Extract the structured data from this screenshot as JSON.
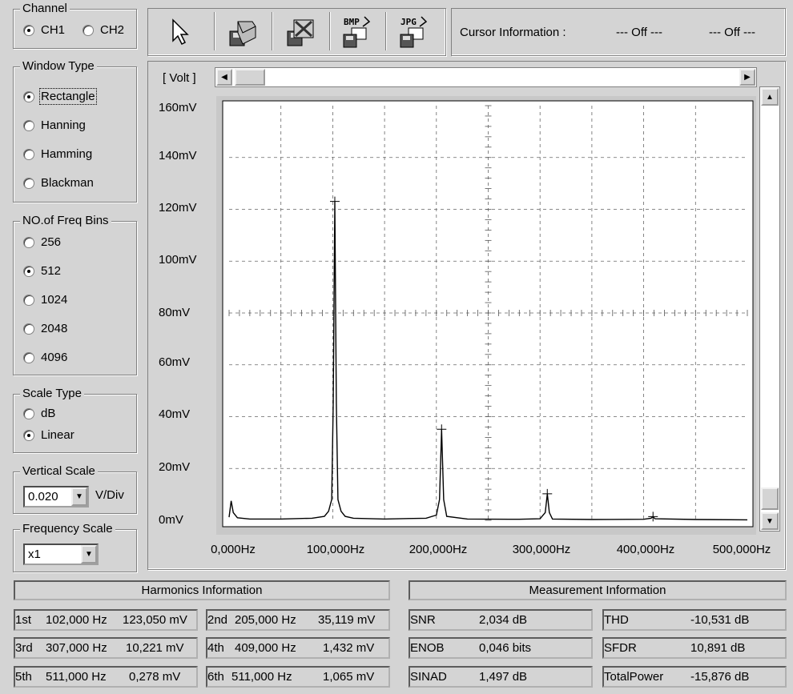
{
  "channel": {
    "title": "Channel",
    "options": [
      {
        "label": "CH1",
        "selected": true
      },
      {
        "label": "CH2",
        "selected": false
      }
    ]
  },
  "window_type": {
    "title": "Window Type",
    "options": [
      {
        "label": "Rectangle",
        "selected": true
      },
      {
        "label": "Hanning",
        "selected": false
      },
      {
        "label": "Hamming",
        "selected": false
      },
      {
        "label": "Blackman",
        "selected": false
      }
    ]
  },
  "freq_bins": {
    "title": "NO.of Freq Bins",
    "options": [
      {
        "label": "256",
        "selected": false
      },
      {
        "label": "512",
        "selected": true
      },
      {
        "label": "1024",
        "selected": false
      },
      {
        "label": "2048",
        "selected": false
      },
      {
        "label": "4096",
        "selected": false
      }
    ]
  },
  "scale_type": {
    "title": "Scale Type",
    "options": [
      {
        "label": "dB",
        "selected": false
      },
      {
        "label": "Linear",
        "selected": true
      }
    ]
  },
  "vertical_scale": {
    "title": "Vertical Scale",
    "value": "0.020",
    "unit": "V/Div"
  },
  "frequency_scale": {
    "title": "Frequency Scale",
    "value": "x1"
  },
  "toolbar": {
    "icons": [
      "cursor-arrow-icon",
      "save-disk-icon",
      "clear-disk-icon",
      "bmp-export-icon",
      "jpg-export-icon"
    ],
    "bmp_text": "BMP",
    "jpg_text": "JPG"
  },
  "cursor_info": {
    "label": "Cursor Information :",
    "value1": "--- Off ---",
    "value2": "--- Off ---"
  },
  "plot": {
    "unit_label": "[ Volt ]",
    "horizontal_scroll_position": 0.0,
    "vertical_scroll_position": 1.0
  },
  "chart_data": {
    "type": "line",
    "title": "",
    "xlabel": "",
    "ylabel": "[ Volt ]",
    "xlim": [
      0,
      500000
    ],
    "ylim": [
      0,
      160
    ],
    "y_ticks": [
      "160mV",
      "140mV",
      "120mV",
      "100mV",
      "80mV",
      "60mV",
      "40mV",
      "20mV",
      "0mV"
    ],
    "x_ticks": [
      "0,000Hz",
      "100,000Hz",
      "200,000Hz",
      "300,000Hz",
      "400,000Hz",
      "500,000Hz"
    ],
    "grid": true,
    "series": [
      {
        "x": [
          0,
          2000,
          4000,
          8000,
          20000,
          50000,
          80000,
          92000,
          96000,
          99000,
          100500,
          102000,
          103500,
          105000,
          108000,
          112000,
          120000,
          150000,
          190000,
          200000,
          203000,
          205000,
          207000,
          210000,
          230000,
          280000,
          300000,
          305000,
          307000,
          309000,
          312000,
          350000,
          400000,
          407000,
          409000,
          411000,
          450000,
          500000
        ],
        "y": [
          1.2,
          7.5,
          3.0,
          1.0,
          0.5,
          0.5,
          0.8,
          1.5,
          3.5,
          8.0,
          45.0,
          123.0,
          45.0,
          8.0,
          3.5,
          1.5,
          0.8,
          0.5,
          0.8,
          2.0,
          8.0,
          35.0,
          8.0,
          1.5,
          0.5,
          0.4,
          0.6,
          3.0,
          10.2,
          3.0,
          0.5,
          0.3,
          0.4,
          0.8,
          1.4,
          0.6,
          0.3,
          0.2
        ]
      }
    ],
    "markers": [
      {
        "x": 102000,
        "y": 123.05
      },
      {
        "x": 205000,
        "y": 35.119
      },
      {
        "x": 307000,
        "y": 10.221
      },
      {
        "x": 409000,
        "y": 1.432
      }
    ]
  },
  "harmonics": {
    "title": "Harmonics Information",
    "rows": [
      {
        "order": "1st",
        "freq": "102,000 Hz",
        "value": "123,050 mV"
      },
      {
        "order": "2nd",
        "freq": "205,000 Hz",
        "value": "35,119 mV"
      },
      {
        "order": "3rd",
        "freq": "307,000 Hz",
        "value": "10,221 mV"
      },
      {
        "order": "4th",
        "freq": "409,000 Hz",
        "value": "1,432 mV"
      },
      {
        "order": "5th",
        "freq": "511,000 Hz",
        "value": "0,278 mV"
      },
      {
        "order": "6th",
        "freq": "511,000 Hz",
        "value": "1,065 mV"
      }
    ]
  },
  "measurement": {
    "title": "Measurement Information",
    "rows": [
      {
        "name": "SNR",
        "value": "2,034 dB"
      },
      {
        "name": "THD",
        "value": "-10,531 dB"
      },
      {
        "name": "ENOB",
        "value": "0,046 bits"
      },
      {
        "name": "SFDR",
        "value": "10,891 dB"
      },
      {
        "name": "SINAD",
        "value": "1,497 dB"
      },
      {
        "name": "TotalPower",
        "value": "-15,876 dB"
      }
    ]
  }
}
